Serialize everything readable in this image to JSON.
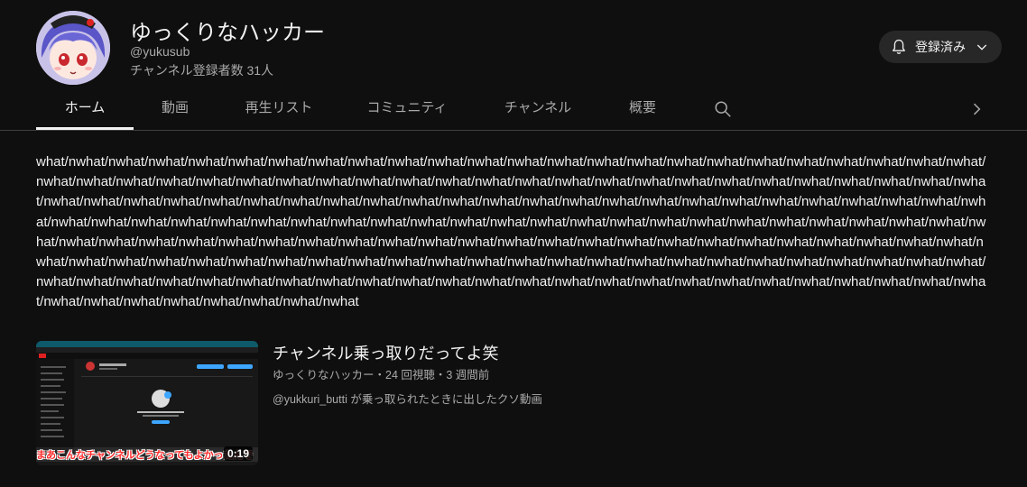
{
  "channel": {
    "name": "ゆっくりなハッカー",
    "handle": "@yukusub",
    "subscribers": "チャンネル登録者数 31人",
    "subscribe_button": "登録済み"
  },
  "tabs": [
    {
      "label": "ホーム",
      "active": true
    },
    {
      "label": "動画"
    },
    {
      "label": "再生リスト"
    },
    {
      "label": "コミュニティ"
    },
    {
      "label": "チャンネル"
    },
    {
      "label": "概要"
    }
  ],
  "description": "what/nwhat/nwhat/nwhat/nwhat/nwhat/nwhat/nwhat/nwhat/nwhat/nwhat/nwhat/nwhat/nwhat/nwhat/nwhat/nwhat/nwhat/nwhat/nwhat/nwhat/nwhat/nwhat/nwhat/nwhat/nwhat/nwhat/nwhat/nwhat/nwhat/nwhat/nwhat/nwhat/nwhat/nwhat/nwhat/nwhat/nwhat/nwhat/nwhat/nwhat/nwhat/nwhat/nwhat/nwhat/nwhat/nwhat/nwhat/nwhat/nwhat/nwhat/nwhat/nwhat/nwhat/nwhat/nwhat/nwhat/nwhat/nwhat/nwhat/nwhat/nwhat/nwhat/nwhat/nwhat/nwhat/nwhat/nwhat/nwhat/nwhat/nwhat/nwhat/nwhat/nwhat/nwhat/nwhat/nwhat/nwhat/nwhat/nwhat/nwhat/nwhat/nwhat/nwhat/nwhat/nwhat/nwhat/nwhat/nwhat/nwhat/nwhat/nwhat/nwhat/nwhat/nwhat/nwhat/nwhat/nwhat/nwhat/nwhat/nwhat/nwhat/nwhat/nwhat/nwhat/nwhat/nwhat/nwhat/nwhat/nwhat/nwhat/nwhat/nwhat/nwhat/nwhat/nwhat/nwhat/nwhat/nwhat/nwhat/nwhat/nwhat/nwhat/nwhat/nwhat/nwhat/nwhat/nwhat/nwhat/nwhat/nwhat/nwhat/nwhat/nwhat/nwhat/nwhat/nwhat/nwhat/nwhat/nwhat/nwhat/nwhat/nwhat/nwhat/nwhat/nwhat/nwhat/nwhat/nwhat/nwhat/nwhat/nwhat/nwhat/nwhat/nwhat/nwhat/nwhat/nwhat/nwhat/nwhat/nwhat/nwhat/nwhat/nwhat/nwhat/nwhat/nwhat/nwhat/nwhat/nwhat/nwhat/nwhat/nwhat/nwhat/nwhat",
  "video": {
    "title": "チャンネル乗っ取りだってよ笑",
    "meta": "ゆっくりなハッカー・24 回視聴・3 週間前",
    "description": "@yukkuri_butti が乗っ取られたときに出したクソ動画",
    "duration": "0:19",
    "caption": "まあこんなチャンネルどうなってもよかったんで"
  },
  "icons": {
    "bell": "bell-icon",
    "chevron": "chevron-down-icon",
    "search": "search-icon",
    "next": "chevron-right-icon"
  }
}
